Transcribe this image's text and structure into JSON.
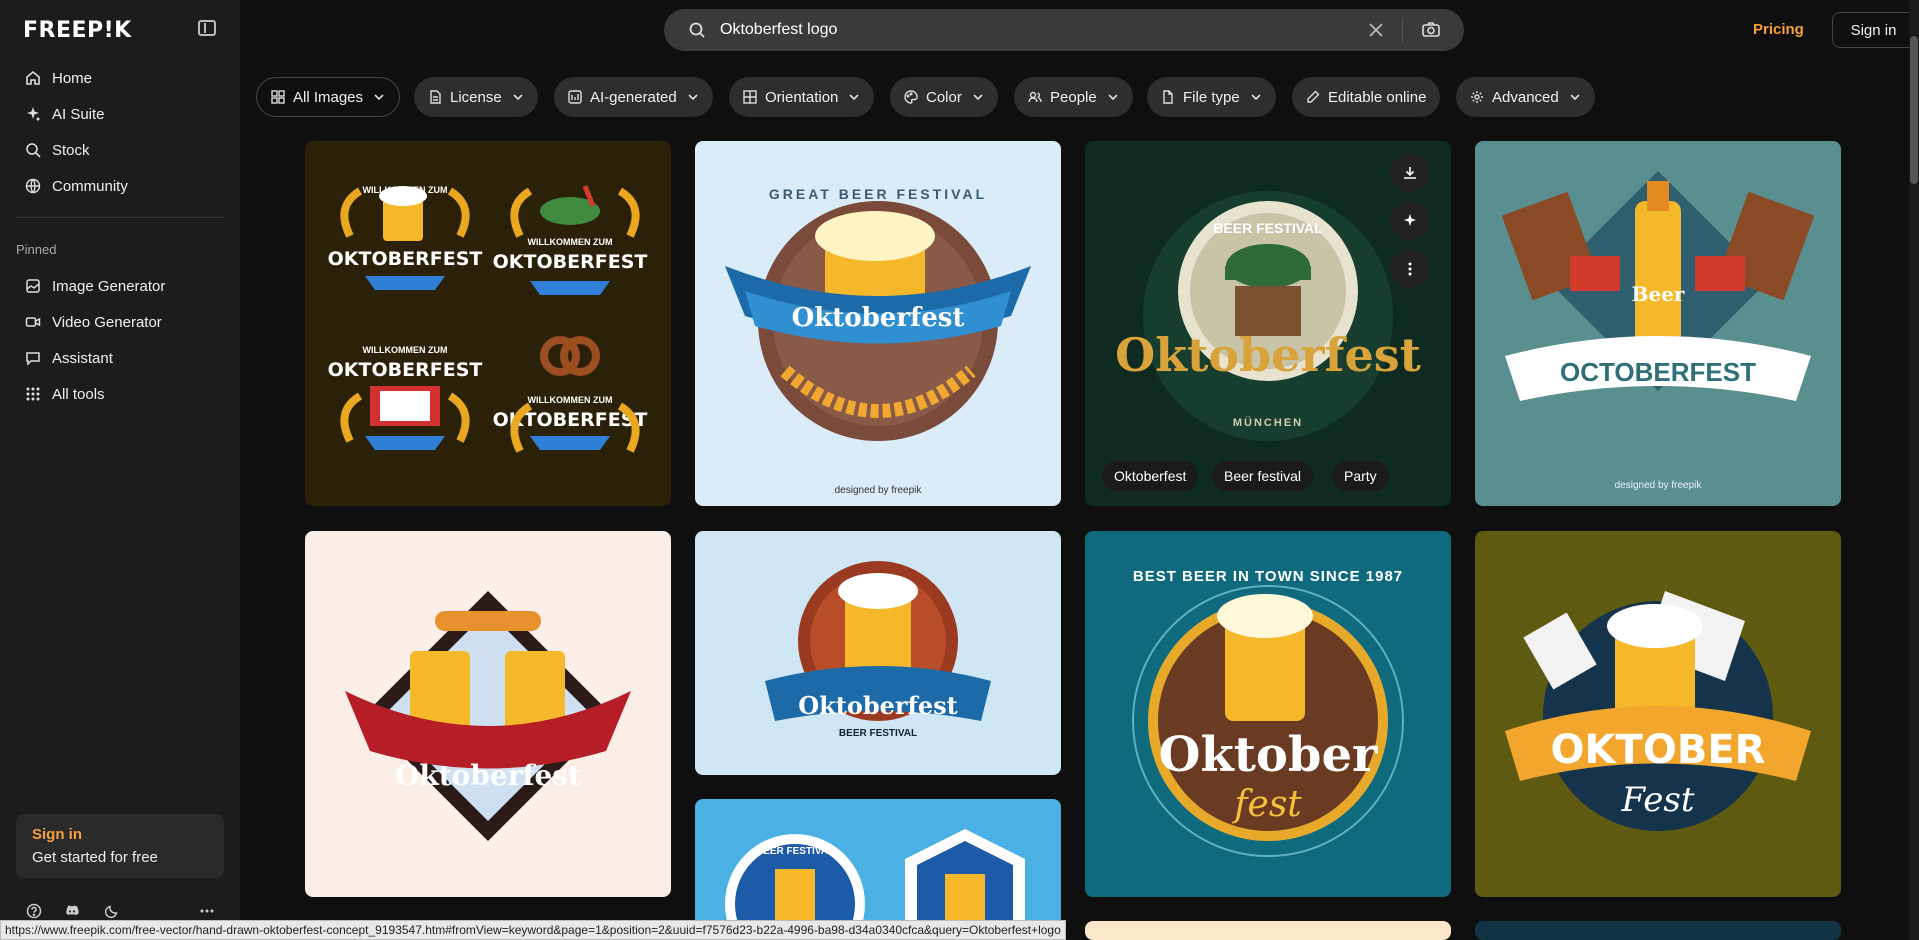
{
  "brand": {
    "logo": "FREEP!K"
  },
  "sidebar": {
    "main_items": [
      {
        "label": "Home",
        "icon": "home-icon"
      },
      {
        "label": "AI Suite",
        "icon": "sparkle-icon"
      },
      {
        "label": "Stock",
        "icon": "search-icon"
      },
      {
        "label": "Community",
        "icon": "globe-icon"
      }
    ],
    "pinned_label": "Pinned",
    "pinned_items": [
      {
        "label": "Image Generator",
        "icon": "image-icon"
      },
      {
        "label": "Video Generator",
        "icon": "video-icon"
      },
      {
        "label": "Assistant",
        "icon": "chat-icon"
      },
      {
        "label": "All tools",
        "icon": "grid-icon"
      }
    ],
    "signin_card": {
      "title": "Sign in",
      "subtitle": "Get started for free"
    }
  },
  "search": {
    "value": "Oktoberfest logo"
  },
  "header": {
    "pricing_label": "Pricing",
    "signin_label": "Sign in"
  },
  "filters": [
    {
      "label": "All Images",
      "icon": "grid-icon",
      "chevron": true
    },
    {
      "label": "License",
      "icon": "document-icon",
      "chevron": true
    },
    {
      "label": "AI-generated",
      "icon": "ai-image-icon",
      "chevron": true
    },
    {
      "label": "Orientation",
      "icon": "orientation-icon",
      "chevron": true
    },
    {
      "label": "Color",
      "icon": "palette-icon",
      "chevron": true
    },
    {
      "label": "People",
      "icon": "people-icon",
      "chevron": true
    },
    {
      "label": "File type",
      "icon": "file-icon",
      "chevron": true
    },
    {
      "label": "Editable online",
      "icon": "pen-icon",
      "chevron": false
    },
    {
      "label": "Advanced",
      "icon": "settings-icon",
      "chevron": true
    }
  ],
  "results": [
    {
      "texts": [
        "WILLKOMMEN ZUM",
        "OKTOBERFEST",
        "WILLKOMMEN ZUM",
        "OKTOBERFEST",
        "WILLKOMMEN ZUM",
        "OKTOBERFEST",
        "WILLKOMMEN ZUM",
        "OKTOBERFEST"
      ],
      "bg": "#2b2108"
    },
    {
      "texts": [
        "GREAT BEER FESTIVAL",
        "Oktoberfest",
        "designed by freepik"
      ],
      "bg": "#d9ecf7"
    },
    {
      "texts": [
        "BEER FESTIVAL",
        "Oktoberfest",
        "MÜNCHEN"
      ],
      "bg": "#0f2a20",
      "tags": [
        "Oktoberfest",
        "Beer festival",
        "Party"
      ]
    },
    {
      "texts": [
        "Beer",
        "OCTOBERFEST",
        "designed by freepik"
      ],
      "bg": "#5a8f8f"
    },
    {
      "texts": [
        "Oktoberfest"
      ],
      "bg": "#fbeee6"
    },
    {
      "texts": [
        "Oktoberfest",
        "BEER FESTIVAL"
      ],
      "bg": "#cfe6f5"
    },
    {
      "texts": [
        "BEST BEER IN TOWN SINCE 1987",
        "Oktober",
        "fest"
      ],
      "bg": "#0f6a7e"
    },
    {
      "texts": [
        "OKTOBER",
        "Fest"
      ],
      "bg": "#5f5a12"
    },
    {
      "texts": [
        "BEER FESTIVAL"
      ],
      "bg": "#4bb0e4"
    }
  ],
  "statusbar": {
    "url": "https://www.freepik.com/free-vector/hand-drawn-oktoberfest-concept_9193547.htm#fromView=keyword&page=1&position=2&uuid=f7576d23-b22a-4996-ba98-d34a0340cfca&query=Oktoberfest+logo"
  },
  "colors": {
    "accent": "#f5a03c",
    "background": "#0f0f0f",
    "sidebar": "#1c1c1c",
    "chip": "#2e2e2e"
  }
}
